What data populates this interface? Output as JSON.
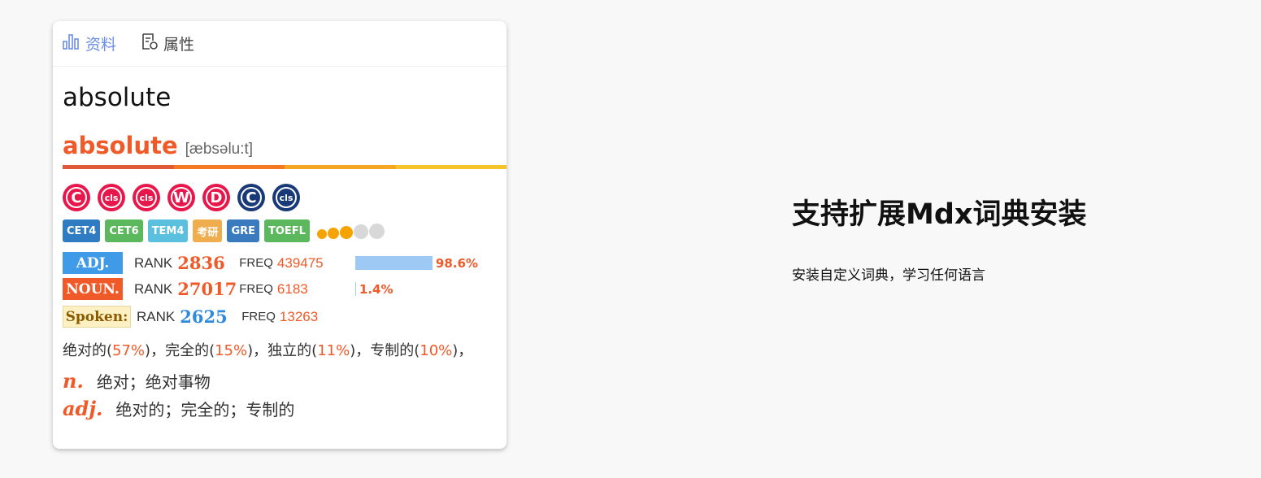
{
  "tabs": [
    {
      "label": "资料",
      "icon": "bar-chart-icon",
      "active": true
    },
    {
      "label": "属性",
      "icon": "document-settings-icon",
      "active": false
    }
  ],
  "headword": "absolute",
  "entry": {
    "word": "absolute",
    "phonetic": "[æbsəlu:t]"
  },
  "colorbar": [
    "#e05a3a",
    "#f47a21",
    "#f5a623",
    "#f5c32a"
  ],
  "dictionaries": [
    {
      "icon": "collins-c-icon",
      "glyph": "C",
      "color": "#e8174b"
    },
    {
      "icon": "collins-cls-icon",
      "glyph": "cls",
      "color": "#e8174b"
    },
    {
      "icon": "collins-cls-icon",
      "glyph": "cls",
      "color": "#e8174b"
    },
    {
      "icon": "webster-w-icon",
      "glyph": "W",
      "color": "#e8174b"
    },
    {
      "icon": "d-icon",
      "glyph": "D",
      "color": "#e8174b"
    },
    {
      "icon": "c-dark-icon",
      "glyph": "C",
      "color": "#183a78"
    },
    {
      "icon": "cls-dark-icon",
      "glyph": "cls",
      "color": "#183a78"
    }
  ],
  "tags": [
    {
      "label": "CET4",
      "color": "#2f7cc2"
    },
    {
      "label": "CET6",
      "color": "#5cb85c"
    },
    {
      "label": "TEM4",
      "color": "#5bc0de"
    },
    {
      "label": "考研",
      "color": "#f0ad4e"
    },
    {
      "label": "GRE",
      "color": "#3a7bbf"
    },
    {
      "label": "TOEFL",
      "color": "#5cb85c"
    }
  ],
  "star_rating": {
    "filled": 3,
    "total": 5
  },
  "pos_stats": [
    {
      "pos": "ADJ.",
      "rank_label": "RANK",
      "rank": "2836",
      "freq_label": "FREQ",
      "freq": "439475",
      "percent": "98.6%",
      "ratio": 0.986,
      "bg": "#3f9be8",
      "fg": "#ffffff",
      "rank_color": "#f05a28"
    },
    {
      "pos": "NOUN.",
      "rank_label": "RANK",
      "rank": "27017",
      "freq_label": "FREQ",
      "freq": "6183",
      "percent": "1.4%",
      "ratio": 0.014,
      "bg": "#f05a28",
      "fg": "#ffffff",
      "rank_color": "#f05a28"
    }
  ],
  "spoken": {
    "pos": "Spoken:",
    "rank_label": "RANK",
    "rank": "2625",
    "freq_label": "FREQ",
    "freq": "13263",
    "bg": "#fdf1c4",
    "fg": "#8a5a00",
    "rank_color": "#2f8ae0"
  },
  "translations": [
    {
      "word": "绝对的",
      "p": "57%"
    },
    {
      "word": "完全的",
      "p": "15%"
    },
    {
      "word": "独立的",
      "p": "11%"
    },
    {
      "word": "专制的",
      "p": "10%"
    }
  ],
  "definitions": [
    {
      "pos": "n.",
      "text": "绝对；绝对事物"
    },
    {
      "pos": "adj.",
      "text": "绝对的；完全的；专制的"
    }
  ],
  "feature": {
    "title": "支持扩展Mdx词典安装",
    "subtitle": "安装自定义词典，学习任何语言"
  }
}
